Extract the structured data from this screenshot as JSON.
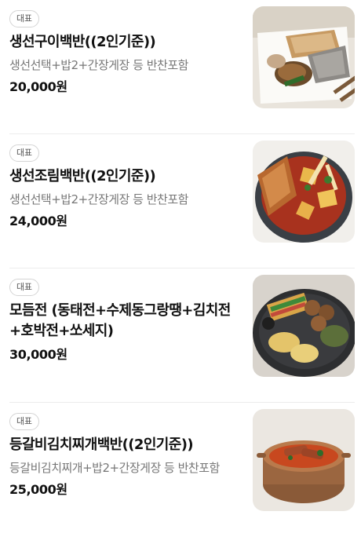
{
  "menu": {
    "items": [
      {
        "badge": "대표",
        "name": "생선구이백반((2인기준))",
        "description": "생선선택+밥2+간장게장 등 반찬포함",
        "price": "20,000원"
      },
      {
        "badge": "대표",
        "name": "생선조림백반((2인기준))",
        "description": "생선선택+밥2+간장게장 등 반찬포함",
        "price": "24,000원"
      },
      {
        "badge": "대표",
        "name": "모듬전 (동태전+수제동그랑땡+김치전+호박전+쏘세지)",
        "description": "",
        "price": "30,000원"
      },
      {
        "badge": "대표",
        "name": "등갈비김치찌개백반((2인기준))",
        "description": "등갈비김치찌개+밥2+간장게장 등 반찬포함",
        "price": "25,000원"
      }
    ]
  }
}
